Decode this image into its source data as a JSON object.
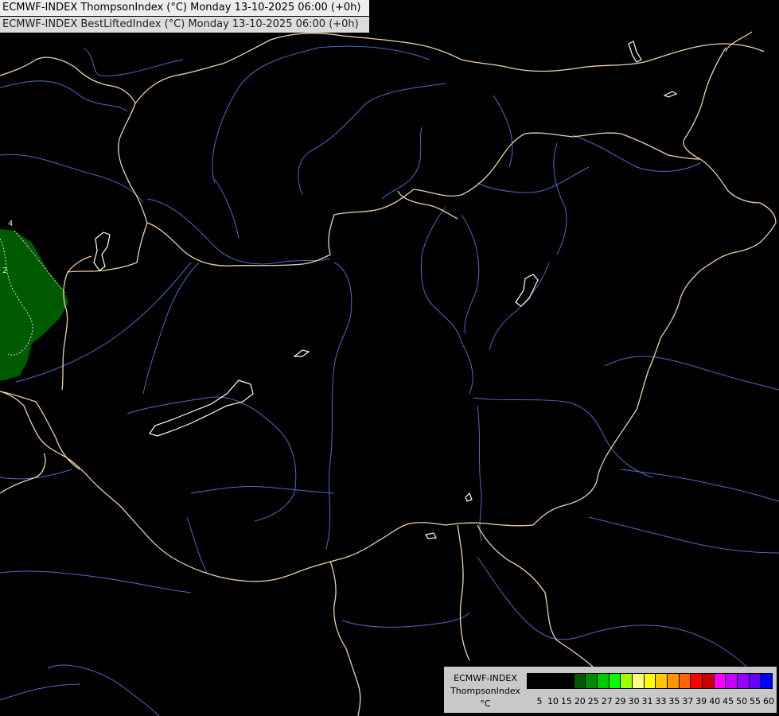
{
  "titles": {
    "line1": "ECMWF-INDEX ThompsonIndex (°C) Monday 13-10-2025 06:00 (+0h)",
    "line2": "ECMWF-INDEX BestLiftedIndex (°C) Monday 13-10-2025 06:00 (+0h)"
  },
  "contour_labels": [
    "4",
    "2"
  ],
  "legend": {
    "line1": "ECMWF-INDEX",
    "line2": "ThompsonIndex",
    "line3": "°C",
    "colors": [
      "#000000",
      "#000000",
      "#000000",
      "#000000",
      "#005a00",
      "#008c00",
      "#00c800",
      "#00ff00",
      "#a0ff00",
      "#ffff80",
      "#ffff00",
      "#ffc800",
      "#ff9600",
      "#ff6400",
      "#ff0000",
      "#c80000",
      "#ff00ff",
      "#c800ff",
      "#9600ff",
      "#6400ff",
      "#0000ff"
    ],
    "ticks": [
      "5",
      "10",
      "15",
      "20",
      "25",
      "27",
      "29",
      "30",
      "31",
      "33",
      "35",
      "37",
      "39",
      "40",
      "45",
      "50",
      "55",
      "60"
    ]
  },
  "colors": {
    "border": "#f0d2a8",
    "river": "#4f6ac8",
    "lake": "#ffffff",
    "green_zone": "#005a00"
  }
}
